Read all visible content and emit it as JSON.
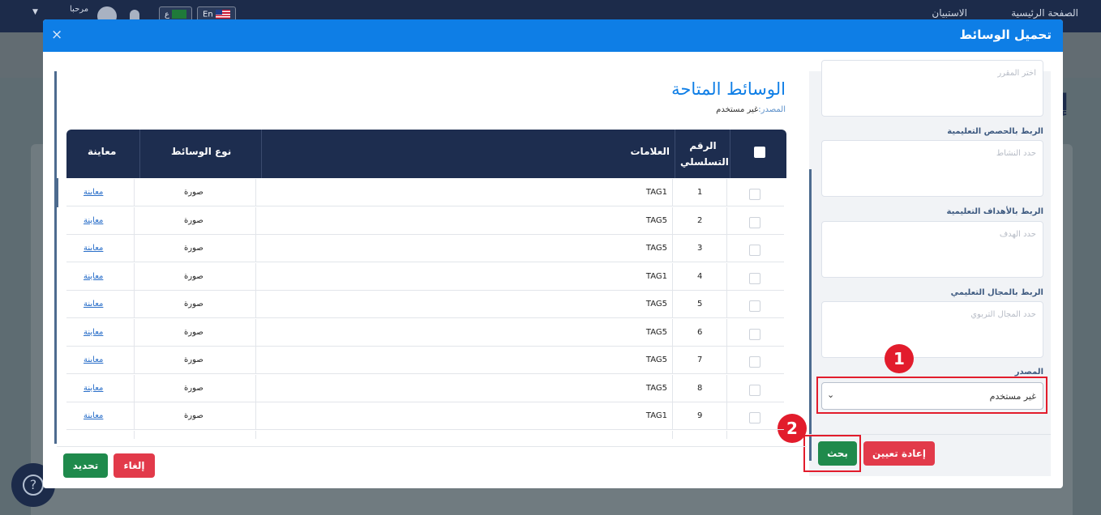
{
  "app": {
    "nav_home": "الصفحة الرئيسية",
    "nav_survey": "الاستبيان",
    "greeting": "مرحبا",
    "lang_en": "En",
    "lang_ar": "ع",
    "help_icon": "?"
  },
  "modal": {
    "title": "تحميل الوسائط",
    "close_icon": "×"
  },
  "filters": {
    "course_placeholder": "اختر المقرر",
    "lessons_label": "الربط بالحصص التعليمية",
    "lessons_placeholder": "حدد النشاط",
    "objectives_label": "الربط بالأهداف التعليمية",
    "objectives_placeholder": "حدد الهدف",
    "domain_label": "الربط بالمجال التعليمي",
    "domain_placeholder": "حدد المجال التربوي",
    "source_label": "المصدر",
    "source_value": "غير مستخدم",
    "reset_button": "إعادة تعيين",
    "search_button": "بحث",
    "badge_1": "1",
    "badge_2": "2"
  },
  "media": {
    "title": "الوسائط المتاحة",
    "source_label": "المصدر:",
    "source_value": "غير مستخدم",
    "columns": {
      "serial": "الرقم التسلسلي",
      "tags": "العلامات",
      "type": "نوع الوسائط",
      "preview": "معاينة"
    },
    "rows": [
      {
        "n": "1",
        "tag": "TAG1",
        "type": "صورة",
        "preview": "معاينة"
      },
      {
        "n": "2",
        "tag": "TAG5",
        "type": "صورة",
        "preview": "معاينة"
      },
      {
        "n": "3",
        "tag": "TAG5",
        "type": "صورة",
        "preview": "معاينة"
      },
      {
        "n": "4",
        "tag": "TAG1",
        "type": "صورة",
        "preview": "معاينة"
      },
      {
        "n": "5",
        "tag": "TAG5",
        "type": "صورة",
        "preview": "معاينة"
      },
      {
        "n": "6",
        "tag": "TAG5",
        "type": "صورة",
        "preview": "معاينة"
      },
      {
        "n": "7",
        "tag": "TAG5",
        "type": "صورة",
        "preview": "معاينة"
      },
      {
        "n": "8",
        "tag": "TAG5",
        "type": "صورة",
        "preview": "معاينة"
      },
      {
        "n": "9",
        "tag": "TAG1",
        "type": "صورة",
        "preview": "معاينة"
      }
    ],
    "cancel_button": "إلغاء",
    "select_button": "تحديد"
  },
  "colors": {
    "header_blue": "#0e7ee6",
    "table_header": "#1d2d4f",
    "accent_green": "#1f8a4c",
    "accent_red": "#e23a4a",
    "highlight_red": "#e21c2c"
  }
}
